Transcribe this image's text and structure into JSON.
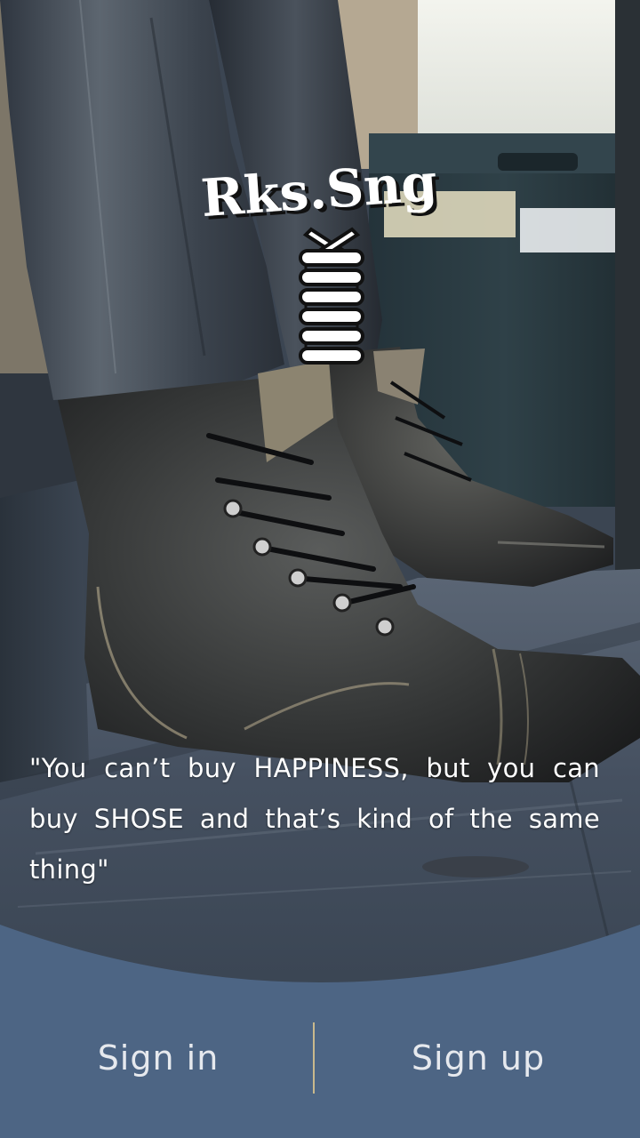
{
  "brand": {
    "name": "Rks.Sng",
    "logo_icon": "shoelace-icon"
  },
  "quote": {
    "text": "\"You can’t buy HAPPINESS, but you can buy  SHOSE and that’s kind of the same thing\""
  },
  "auth": {
    "sign_in_label": "Sign in",
    "sign_up_label": "Sign up"
  },
  "colors": {
    "panel": "#4d6584",
    "divider": "#c9b98c",
    "text": "#e6e9ee"
  }
}
